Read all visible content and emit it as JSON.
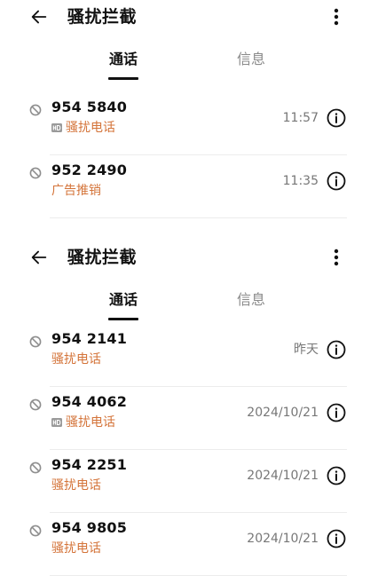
{
  "screens": [
    {
      "title": "骚扰拦截",
      "tabs": [
        {
          "label": "通话"
        },
        {
          "label": "信息"
        }
      ],
      "calls": [
        {
          "number": "954 5840",
          "tag": "骚扰电话",
          "hd": true,
          "time": "11:57"
        },
        {
          "number": "952 2490",
          "tag": "广告推销",
          "hd": false,
          "time": "11:35"
        }
      ]
    },
    {
      "title": "骚扰拦截",
      "tabs": [
        {
          "label": "通话"
        },
        {
          "label": "信息"
        }
      ],
      "calls": [
        {
          "number": "954 2141",
          "tag": "骚扰电话",
          "hd": false,
          "time": "昨天"
        },
        {
          "number": "954 4062",
          "tag": "骚扰电话",
          "hd": true,
          "time": "2024/10/21"
        },
        {
          "number": "954 2251",
          "tag": "骚扰电话",
          "hd": false,
          "time": "2024/10/21"
        },
        {
          "number": "954 9805",
          "tag": "骚扰电话",
          "hd": false,
          "time": "2024/10/21"
        }
      ]
    }
  ],
  "icons": {
    "back": "arrow-left-icon",
    "more": "more-vertical-icon",
    "blocked": "block-icon",
    "hd": "hd-icon",
    "info": "info-icon"
  },
  "colors": {
    "tag": "#d4743a",
    "text": "#111111",
    "muted": "#777777",
    "divider": "#ececec"
  }
}
